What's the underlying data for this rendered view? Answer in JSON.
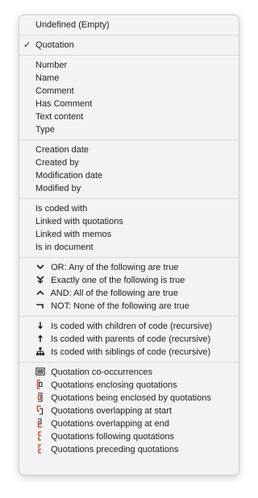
{
  "menu": {
    "g0": {
      "items": [
        {
          "label": "Undefined (Empty)"
        }
      ]
    },
    "g1": {
      "items": [
        {
          "label": "Quotation",
          "checked": true,
          "check": "✓"
        }
      ]
    },
    "g2": {
      "items": [
        {
          "label": "Number"
        },
        {
          "label": "Name"
        },
        {
          "label": "Comment"
        },
        {
          "label": "Has Comment"
        },
        {
          "label": "Text content"
        },
        {
          "label": "Type"
        }
      ]
    },
    "g3": {
      "items": [
        {
          "label": "Creation date"
        },
        {
          "label": "Created by"
        },
        {
          "label": "Modification date"
        },
        {
          "label": "Modified by"
        }
      ]
    },
    "g4": {
      "items": [
        {
          "label": "Is coded with"
        },
        {
          "label": "Linked with quotations"
        },
        {
          "label": "Linked with memos"
        },
        {
          "label": "Is in document"
        }
      ]
    },
    "g5": {
      "items": [
        {
          "label": "OR: Any of the following are true",
          "icon": "chevron-down-icon"
        },
        {
          "label": "Exactly one of the following is true",
          "icon": "exclusive-or-icon"
        },
        {
          "label": "AND: All of the following are true",
          "icon": "chevron-up-icon"
        },
        {
          "label": "NOT: None of the following are true",
          "icon": "not-icon"
        }
      ]
    },
    "g6": {
      "items": [
        {
          "label": "Is coded with children of code (recursive)",
          "icon": "arrow-down-icon"
        },
        {
          "label": "Is coded with parents of code (recursive)",
          "icon": "arrow-up-icon"
        },
        {
          "label": "Is coded with siblings of code (recursive)",
          "icon": "sibling-tree-icon"
        }
      ]
    },
    "g7": {
      "items": [
        {
          "label": "Quotation co-occurrences",
          "icon": "co-occurrence-icon"
        },
        {
          "label": "Quotations enclosing quotations",
          "icon": "enclosing-icon"
        },
        {
          "label": "Quotations being enclosed by quotations",
          "icon": "enclosed-icon"
        },
        {
          "label": "Quotations overlapping at start",
          "icon": "overlap-start-icon"
        },
        {
          "label": "Quotations overlapping at end",
          "icon": "overlap-end-icon"
        },
        {
          "label": "Quotations following quotations",
          "icon": "following-icon"
        },
        {
          "label": "Quotations preceding quotations",
          "icon": "preceding-icon"
        }
      ]
    },
    "colors": {
      "accent_red": "#c43b2b",
      "text": "#1f1f1f",
      "background": "#f3f3f3"
    }
  }
}
